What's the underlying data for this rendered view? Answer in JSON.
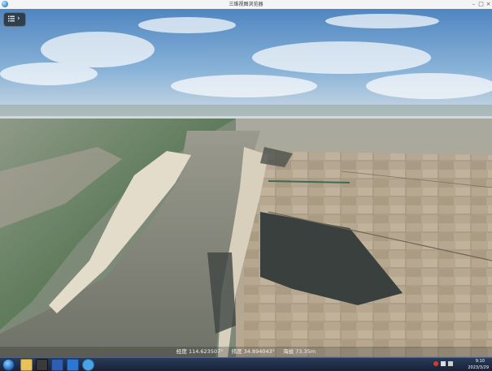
{
  "window": {
    "title": "三维视图浏览器",
    "minimize_glyph": "–",
    "maximize_glyph": "□",
    "close_glyph": "×"
  },
  "toolbar": {
    "layers_icon": "list-icon",
    "expand_glyph": "›"
  },
  "status": {
    "longitude": "经度  114.623507°",
    "latitude": "纬度  34.894043°",
    "altitude": "海拔  73.35m"
  },
  "taskbar": {
    "time": "9:10",
    "date": "2023/3/29"
  },
  "colors": {
    "sky_top": "#5a8fc6",
    "river": "#7b7f74",
    "sandbar": "#e6ddcc",
    "farmland": "#b3a38e",
    "forest": "#3c4340"
  }
}
